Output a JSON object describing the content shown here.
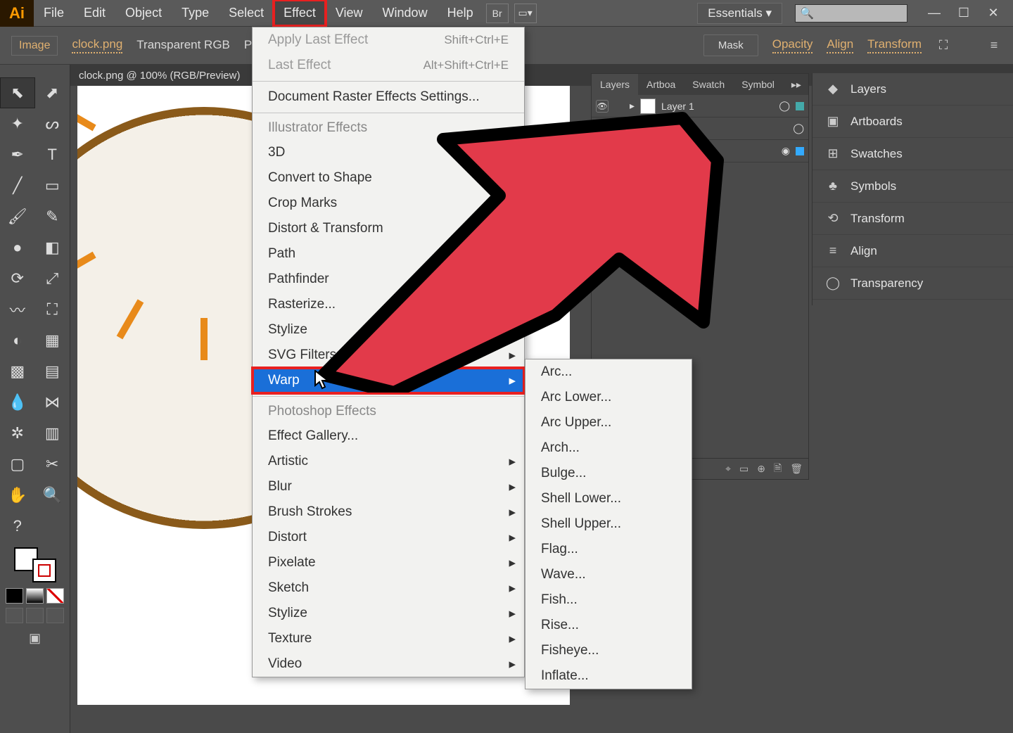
{
  "menubar": {
    "items": [
      "File",
      "Edit",
      "Object",
      "Type",
      "Select",
      "Effect",
      "View",
      "Window",
      "Help"
    ],
    "highlighted_index": 5,
    "workspace_label": "Essentials"
  },
  "window_controls": {
    "min": "—",
    "max": "☐",
    "close": "✕"
  },
  "optionsbar": {
    "tag": "Image",
    "filename": "clock.png",
    "mode": "Transparent RGB",
    "ppi": "PPI",
    "mask": "Mask",
    "opacity": "Opacity",
    "align": "Align",
    "transform": "Transform"
  },
  "doc_tab": "clock.png @ 100% (RGB/Preview)",
  "effect_menu": {
    "apply_last": "Apply Last Effect",
    "apply_last_sc": "Shift+Ctrl+E",
    "last": "Last Effect",
    "last_sc": "Alt+Shift+Ctrl+E",
    "doc_raster": "Document Raster Effects Settings...",
    "ill_header": "Illustrator Effects",
    "ill_items": [
      "3D",
      "Convert to Shape",
      "Crop Marks",
      "Distort & Transform",
      "Path",
      "Pathfinder",
      "Rasterize...",
      "Stylize",
      "SVG Filters",
      "Warp"
    ],
    "ps_header": "Photoshop Effects",
    "ps_items": [
      "Effect Gallery...",
      "Artistic",
      "Blur",
      "Brush Strokes",
      "Distort",
      "Pixelate",
      "Sketch",
      "Stylize",
      "Texture",
      "Video"
    ]
  },
  "warp_submenu": [
    "Arc...",
    "Arc Lower...",
    "Arc Upper...",
    "Arch...",
    "Bulge...",
    "Shell Lower...",
    "Shell Upper...",
    "Flag...",
    "Wave...",
    "Fish...",
    "Rise...",
    "Fisheye...",
    "Inflate..."
  ],
  "layers_panel": {
    "tabs": [
      "Layers",
      "Artboa",
      "Swatch",
      "Symbol"
    ],
    "rows": [
      {
        "name": "Layer 1"
      },
      {
        "name": "."
      },
      {
        "name": "..."
      }
    ]
  },
  "right_dock": [
    {
      "icon": "◆",
      "label": "Layers"
    },
    {
      "icon": "▣",
      "label": "Artboards"
    },
    {
      "icon": "⊞",
      "label": "Swatches"
    },
    {
      "icon": "♣",
      "label": "Symbols"
    },
    {
      "icon": "⟲",
      "label": "Transform"
    },
    {
      "icon": "≡",
      "label": "Align"
    },
    {
      "icon": "◯",
      "label": "Transparency"
    }
  ],
  "tools": {
    "names": [
      "selection",
      "direct-selection",
      "magic-wand",
      "lasso",
      "pen",
      "type",
      "line",
      "rectangle",
      "paintbrush",
      "pencil",
      "blob-brush",
      "eraser",
      "rotate",
      "scale",
      "width",
      "free-transform",
      "shape-builder",
      "perspective",
      "mesh",
      "gradient",
      "eyedropper",
      "blend",
      "symbol-sprayer",
      "column-graph",
      "artboard",
      "slice",
      "hand",
      "zoom"
    ]
  }
}
